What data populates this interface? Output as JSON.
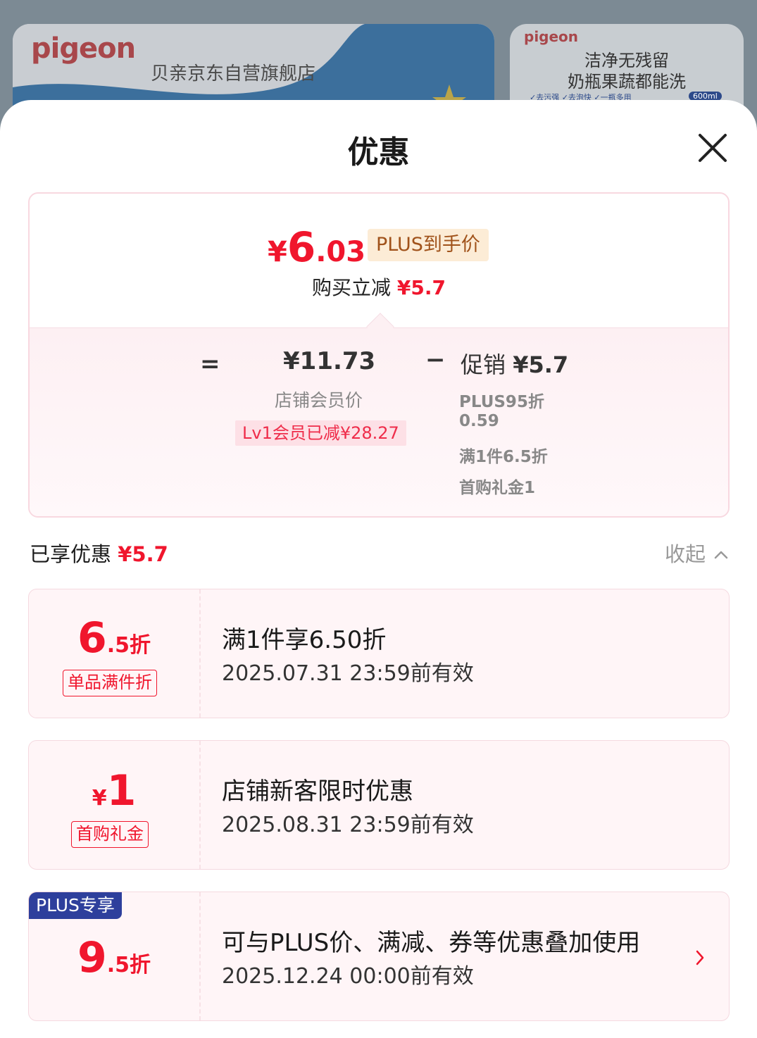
{
  "background": {
    "left_banner": {
      "logo": "pigeon",
      "shop_name": "贝亲京东自营旗舰店"
    },
    "right_banner": {
      "logo": "pigeon",
      "line1": "洁净无残留",
      "line2": "奶瓶果蔬都能洗",
      "tags": "✓去污强  ✓去泡快  ✓一瓶多用",
      "volume": "600ml"
    }
  },
  "sheet": {
    "title": "优惠",
    "close_icon": "close-icon"
  },
  "price_card": {
    "yen": "¥",
    "price_int": "6",
    "price_dec": ".03",
    "plus_badge": "PLUS到手价",
    "instant_label": "购买立减",
    "instant_amount": "¥5.7",
    "eq": "=",
    "member_price": "¥11.73",
    "member_label": "店铺会员价",
    "lv_badge": "Lv1会员已减¥28.27",
    "minus": "−",
    "promo_label": "促销",
    "promo_amount": "¥5.7",
    "promo_lines": [
      "PLUS95折",
      "0.59",
      "满1件6.5折",
      "首购礼金1"
    ]
  },
  "enjoyed": {
    "label": "已享优惠",
    "amount": "¥5.7",
    "collapse": "收起"
  },
  "coupons": [
    {
      "big_int": "6",
      "big_suffix": ".5折",
      "tag": "单品满件折",
      "title": "满1件享6.50折",
      "valid": "2025.07.31 23:59前有效"
    },
    {
      "big_prefix": "¥",
      "big_int": "1",
      "tag": "首购礼金",
      "title": "店铺新客限时优惠",
      "valid": "2025.08.31 23:59前有效"
    },
    {
      "corner": "PLUS专享",
      "big_int": "9",
      "big_suffix": ".5折",
      "title": "可与PLUS价、满减、券等优惠叠加使用",
      "valid": "2025.12.24 00:00前有效"
    }
  ],
  "colors": {
    "accent_red": "#f0162d",
    "plus_blue": "#2e3f9c",
    "plus_gold_bg": "#fcecd6"
  }
}
